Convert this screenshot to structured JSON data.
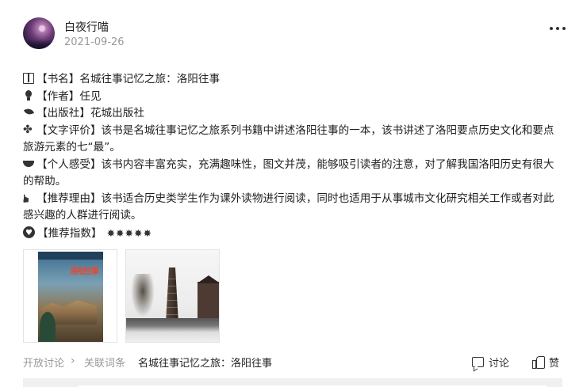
{
  "post": {
    "author": "白夜行喵",
    "date": "2021-09-26"
  },
  "content": {
    "book_name": "【书名】名城往事记忆之旅：洛阳往事",
    "author": "【作者】任见",
    "publisher": "【出版社】花城出版社",
    "review": "【文字评价】该书是名城往事记忆之旅系列书籍中讲述洛阳往事的一本，该书讲述了洛阳要点历史文化和要点旅游元素的七“最”。",
    "feeling": "【个人感受】该书内容丰富充实，充满趣味性，图文并茂，能够吸引读者的注意，对了解我国洛阳历史有很大的帮助。",
    "reason": "【推荐理由】该书适合历史类学生作为课外读物进行阅读，同时也适用于从事城市文化研究相关工作或者对此感兴趣的人群进行阅读。",
    "rating_label": "【推荐指数】",
    "rating_stars": "✸✸✸✸✸",
    "icons": [
      "book-icon",
      "lightbulb-icon",
      "leaf-icon",
      "clover-icon",
      "smile-icon",
      "pointing-hand-icon",
      "heart-icon"
    ]
  },
  "images": {
    "cover_title": "洛阳往事"
  },
  "footer": {
    "open_discussion": "开放讨论",
    "related_entries": "关联词条",
    "topic_link": "名城往事记忆之旅：洛阳往事",
    "discuss_label": "讨论",
    "like_label": "赞"
  }
}
